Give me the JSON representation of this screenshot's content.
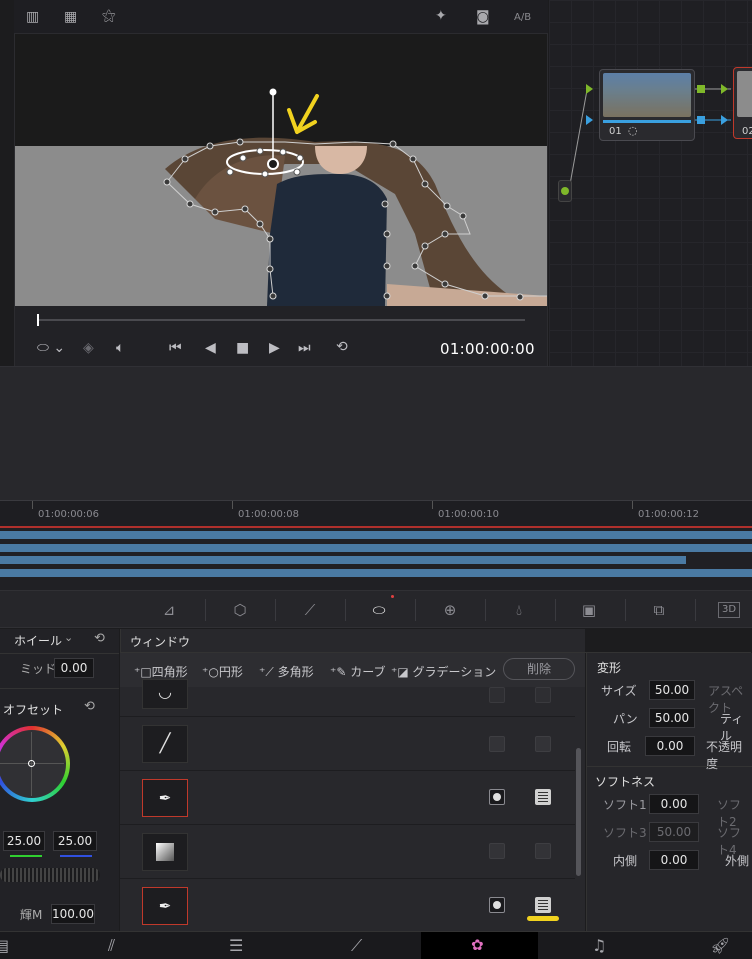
{
  "viewer": {
    "ab_label": "A/B",
    "timecode": "01:00:00:00"
  },
  "node_editor": {
    "node1_label": "01",
    "node2_label": "02"
  },
  "timeline": {
    "ruler_marks": [
      "01:00:00:06",
      "01:00:00:08",
      "01:00:00:10",
      "01:00:00:12"
    ]
  },
  "wheels_panel": {
    "title": "ホイール",
    "mid_label": "ミッド",
    "mid_value": "0.00",
    "offset_label": "オフセット",
    "value_a": "25.00",
    "value_b": "25.00",
    "lum_label": "輝M",
    "lum_value": "100.00"
  },
  "window_panel": {
    "title": "ウィンドウ",
    "tools": {
      "rect": "四角形",
      "circle": "円形",
      "polygon": "多角形",
      "curve": "カーブ",
      "gradient": "グラデーション"
    },
    "delete_label": "削除"
  },
  "transform_panel": {
    "title": "変形",
    "size_label": "サイズ",
    "size_value": "50.00",
    "aspect_label": "アスペクト",
    "pan_label": "パン",
    "pan_value": "50.00",
    "tilt_label": "ティル",
    "rotation_label": "回転",
    "rotation_value": "0.00",
    "opacity_label": "不透明度",
    "softness_title": "ソフトネス",
    "soft1_label": "ソフト1",
    "soft1_value": "0.00",
    "soft2_label": "ソフト2",
    "soft3_label": "ソフト3",
    "soft3_value": "50.00",
    "soft4_label": "ソフト4",
    "inside_label": "内側",
    "inside_value": "0.00",
    "outside_label": "外側"
  },
  "colors": {
    "accent_yellow": "#f1d21f",
    "active_red": "#c0392b",
    "clip_blue": "#4a7aa3",
    "node_green": "#7fb82a"
  }
}
